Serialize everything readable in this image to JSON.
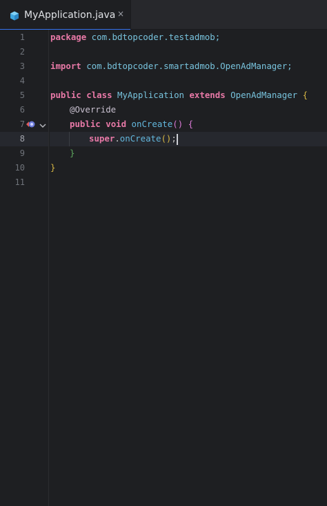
{
  "tab": {
    "title": "MyApplication.java",
    "close_glyph": "×",
    "file_icon": "java-class-icon"
  },
  "gutter": {
    "line_numbers": [
      "1",
      "2",
      "3",
      "4",
      "5",
      "6",
      "7",
      "8",
      "9",
      "10",
      "11"
    ],
    "current_line": "8",
    "line7_marks": [
      "override-method-icon",
      "fold-chevron-icon"
    ]
  },
  "code": {
    "l1": {
      "kw": "package",
      "rest": " com.bdtopcoder.testadmob;"
    },
    "l3": {
      "kw": "import",
      "rest": " com.bdtopcoder.smartadmob.OpenAdManager;"
    },
    "l5": {
      "kw1": "public",
      "kw2": "class",
      "name": "MyApplication",
      "kw3": "extends",
      "parent": "OpenAdManager",
      "brace": "{"
    },
    "l6": {
      "annotation": "@Override"
    },
    "l7": {
      "kw1": "public",
      "kw2": "void",
      "fn": "onCreate",
      "parens": "()",
      "brace": "{"
    },
    "l8": {
      "kw": "super",
      "dot": ".",
      "fn": "onCreate",
      "parens": "()",
      "semi": ";"
    },
    "l9": {
      "brace": "}"
    },
    "l10": {
      "brace": "}"
    }
  },
  "colors": {
    "background": "#1e1f22",
    "tab_accent": "#3574f0",
    "keyword": "#e879a7",
    "package": "#78c3dd",
    "method": "#63b7dd"
  }
}
